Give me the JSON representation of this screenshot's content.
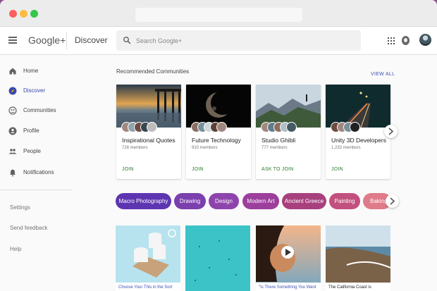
{
  "header": {
    "brand": "Google+",
    "section": "Discover",
    "search_placeholder": "Search Google+"
  },
  "sidebar": {
    "items": [
      {
        "label": "Home",
        "icon": "home-icon"
      },
      {
        "label": "Discover",
        "icon": "compass-icon"
      },
      {
        "label": "Communities",
        "icon": "communities-icon"
      },
      {
        "label": "Profile",
        "icon": "profile-icon"
      },
      {
        "label": "People",
        "icon": "people-icon"
      },
      {
        "label": "Notifications",
        "icon": "bell-icon"
      }
    ],
    "links": [
      "Settings",
      "Send feedback",
      "Help"
    ]
  },
  "main": {
    "recommended_title": "Recommended Communities",
    "view_all": "VIEW ALL",
    "communities": [
      {
        "name": "Inspirational Quotes",
        "members": "728 members",
        "action": "JOIN"
      },
      {
        "name": "Future Technology",
        "members": "910 members",
        "action": "JOIN"
      },
      {
        "name": "Studio Ghibli",
        "members": "777 members",
        "action": "ASK TO JOIN"
      },
      {
        "name": "Unity 3D Developers",
        "members": "1,232 members",
        "action": "JOIN"
      }
    ],
    "chips": [
      "Macro Photography",
      "Drawing",
      "Design",
      "Modern Art",
      "Ancient Greece",
      "Painting",
      "Baking"
    ],
    "posts": [
      {
        "caption": "Choose Your This in the Sort"
      },
      {
        "caption": ""
      },
      {
        "caption": "\"Is There Something You Want"
      },
      {
        "caption": "The California Coast is"
      }
    ]
  },
  "colors": {
    "accent": "#3f51b5",
    "join": "#2e7d32",
    "chip_start": "#5e35b1",
    "chip_end": "#e57373"
  }
}
